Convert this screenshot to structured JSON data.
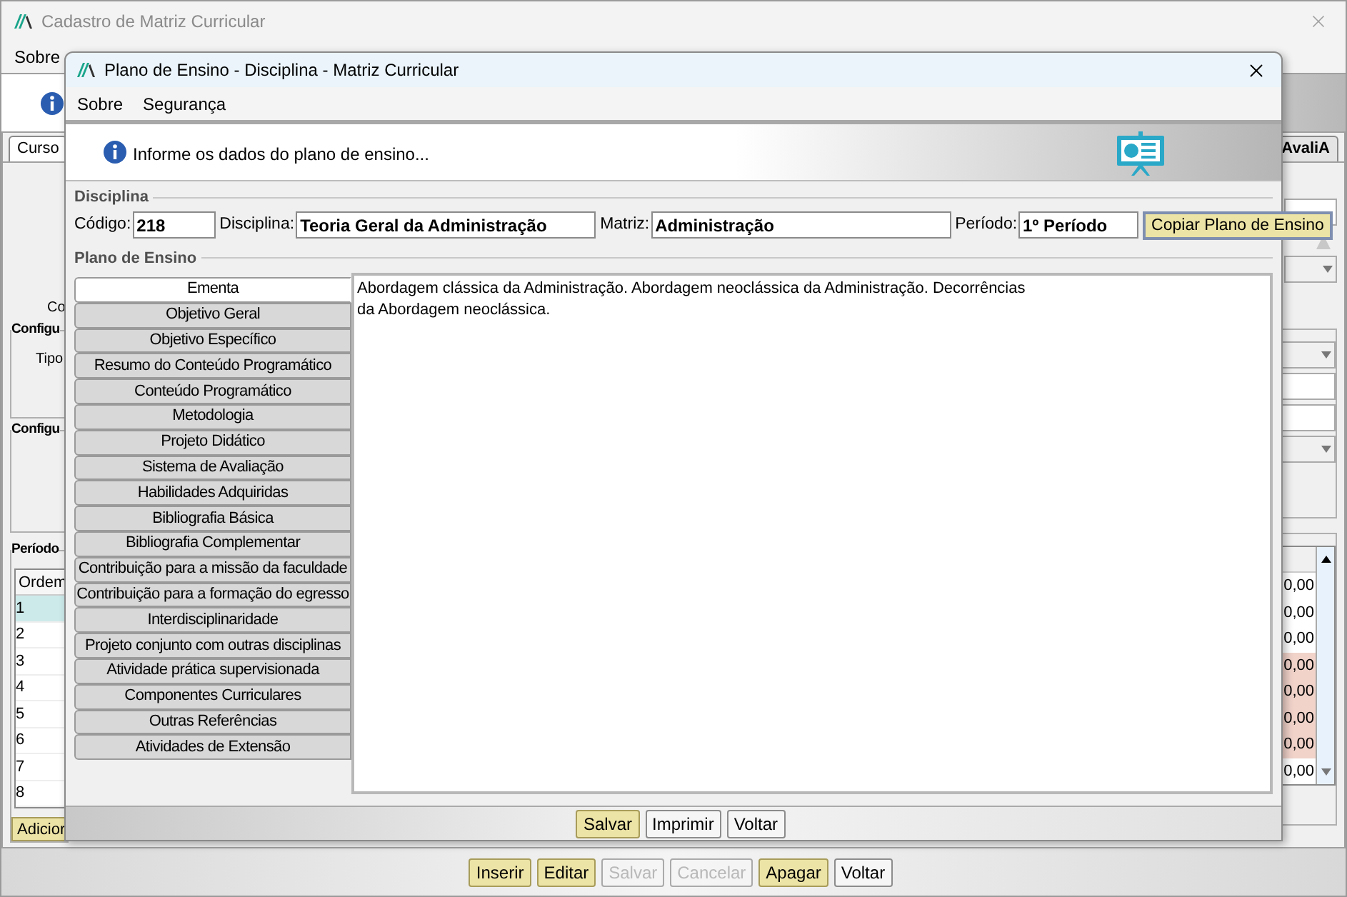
{
  "main_window": {
    "title": "Cadastro de Matriz Curricular",
    "menu": [
      "Sobre"
    ],
    "tabs": [
      {
        "label": "Curso",
        "selected": true
      },
      {
        "label": "AvaliA",
        "selected": false
      }
    ],
    "field_label": "Co",
    "groups": [
      {
        "title": "Configu",
        "label": "Tipo"
      },
      {
        "title": "Configu"
      }
    ],
    "periods": {
      "title": "Período",
      "columns": [
        "Ordem"
      ],
      "add_button": "Adicior",
      "rows": [
        {
          "order": "1",
          "value": "0,00",
          "selected": true,
          "highlight": false
        },
        {
          "order": "2",
          "value": "0,00",
          "selected": false,
          "highlight": false
        },
        {
          "order": "3",
          "value": "0,00",
          "selected": false,
          "highlight": false
        },
        {
          "order": "4",
          "value": "0,00",
          "selected": false,
          "highlight": true
        },
        {
          "order": "5",
          "value": "0,00",
          "selected": false,
          "highlight": true
        },
        {
          "order": "6",
          "value": "0,00",
          "selected": false,
          "highlight": true
        },
        {
          "order": "7",
          "value": "0,00",
          "selected": false,
          "highlight": true
        },
        {
          "order": "8",
          "value": "0,00",
          "selected": false,
          "highlight": false
        }
      ]
    },
    "buttons": [
      {
        "label": "Inserir",
        "highlighted": true,
        "disabled": false
      },
      {
        "label": "Editar",
        "highlighted": true,
        "disabled": false
      },
      {
        "label": "Salvar",
        "highlighted": false,
        "disabled": true
      },
      {
        "label": "Cancelar",
        "highlighted": false,
        "disabled": true
      },
      {
        "label": "Apagar",
        "highlighted": true,
        "disabled": false
      },
      {
        "label": "Voltar",
        "highlighted": false,
        "disabled": false
      }
    ]
  },
  "dialog": {
    "title": "Plano de Ensino - Disciplina - Matriz Curricular",
    "menu": [
      "Sobre",
      "Segurança"
    ],
    "banner": "Informe os dados do plano de ensino...",
    "disciplina": {
      "title": "Disciplina",
      "fields": [
        {
          "label": "Código:",
          "value": "218"
        },
        {
          "label": "Disciplina:",
          "value": "Teoria Geral da Administração"
        },
        {
          "label": "Matriz:",
          "value": "Administração"
        },
        {
          "label": "Período:",
          "value": "1º Período"
        }
      ],
      "copy_button": "Copiar Plano de Ensino"
    },
    "plano": {
      "title": "Plano de Ensino",
      "sections": [
        {
          "label": "Ementa",
          "selected": true
        },
        {
          "label": "Objetivo Geral",
          "selected": false
        },
        {
          "label": "Objetivo Específico",
          "selected": false
        },
        {
          "label": "Resumo do Conteúdo Programático",
          "selected": false
        },
        {
          "label": "Conteúdo Programático",
          "selected": false
        },
        {
          "label": "Metodologia",
          "selected": false
        },
        {
          "label": "Projeto Didático",
          "selected": false
        },
        {
          "label": "Sistema de Avaliação",
          "selected": false
        },
        {
          "label": "Habilidades Adquiridas",
          "selected": false
        },
        {
          "label": "Bibliografia Básica",
          "selected": false
        },
        {
          "label": "Bibliografia Complementar",
          "selected": false
        },
        {
          "label": "Contribuição para a missão da faculdade",
          "selected": false
        },
        {
          "label": "Contribuição para a formação do egresso",
          "selected": false
        },
        {
          "label": "Interdisciplinaridade",
          "selected": false
        },
        {
          "label": "Projeto conjunto com outras disciplinas",
          "selected": false
        },
        {
          "label": "Atividade prática supervisionada",
          "selected": false
        },
        {
          "label": "Componentes Curriculares",
          "selected": false
        },
        {
          "label": "Outras Referências",
          "selected": false
        },
        {
          "label": "Atividades de Extensão",
          "selected": false
        }
      ],
      "text": "Abordagem clássica da Administração. Abordagem neoclássica da Administração. Decorrências\nda Abordagem neoclássica."
    },
    "buttons": [
      {
        "label": "Salvar",
        "highlighted": true
      },
      {
        "label": "Imprimir",
        "highlighted": false
      },
      {
        "label": "Voltar",
        "highlighted": false
      }
    ]
  }
}
